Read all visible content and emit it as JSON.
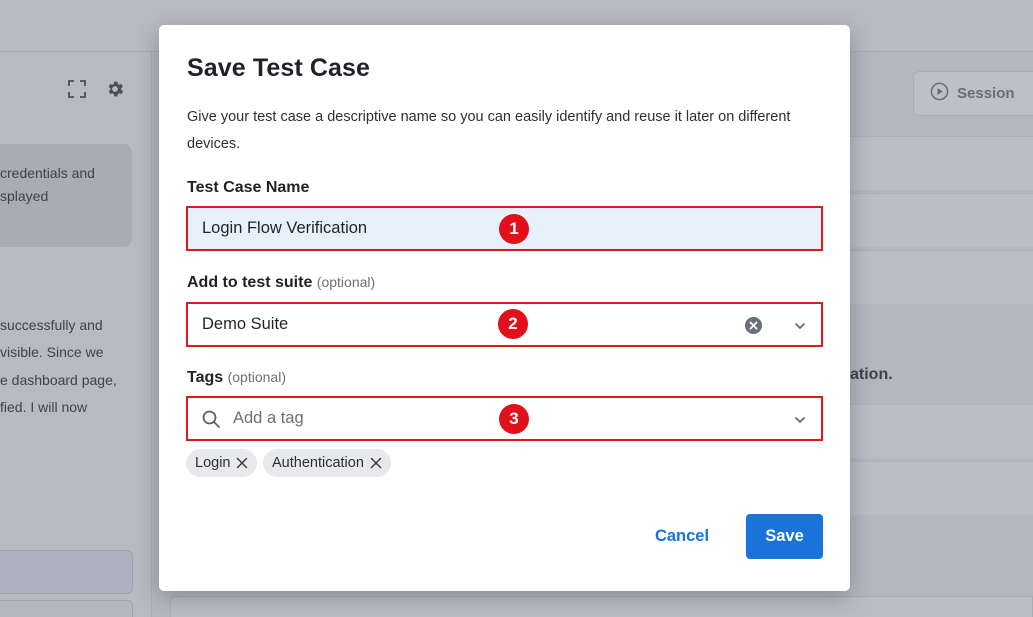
{
  "background": {
    "chat_lines": [
      "credentials and",
      "splayed"
    ],
    "paragraph_lines": [
      "successfully and",
      "visible. Since we",
      "e dashboard page,",
      "fied. I will now"
    ],
    "session_label": "Session",
    "right_fragment": "ation."
  },
  "modal": {
    "title": "Save Test Case",
    "description": "Give your test case a descriptive name so you can easily identify and reuse it later on different devices.",
    "name_field": {
      "label": "Test Case Name",
      "value": "Login Flow Verification",
      "badge": "1"
    },
    "suite_field": {
      "label": "Add to test suite",
      "optional": "(optional)",
      "value": "Demo Suite",
      "badge": "2"
    },
    "tags_field": {
      "label": "Tags",
      "optional": "(optional)",
      "placeholder": "Add a tag",
      "badge": "3",
      "tags": [
        "Login",
        "Authentication"
      ]
    },
    "cancel_label": "Cancel",
    "save_label": "Save"
  },
  "colors": {
    "accent": "#1a73d9",
    "highlight_border": "#e11919",
    "badge": "#e2101a",
    "name_field_bg": "#e8f0fc"
  },
  "icons": [
    "expand-icon",
    "gear-icon",
    "play-circle-icon",
    "search-icon",
    "clear-icon",
    "chevron-down-icon",
    "close-icon"
  ]
}
